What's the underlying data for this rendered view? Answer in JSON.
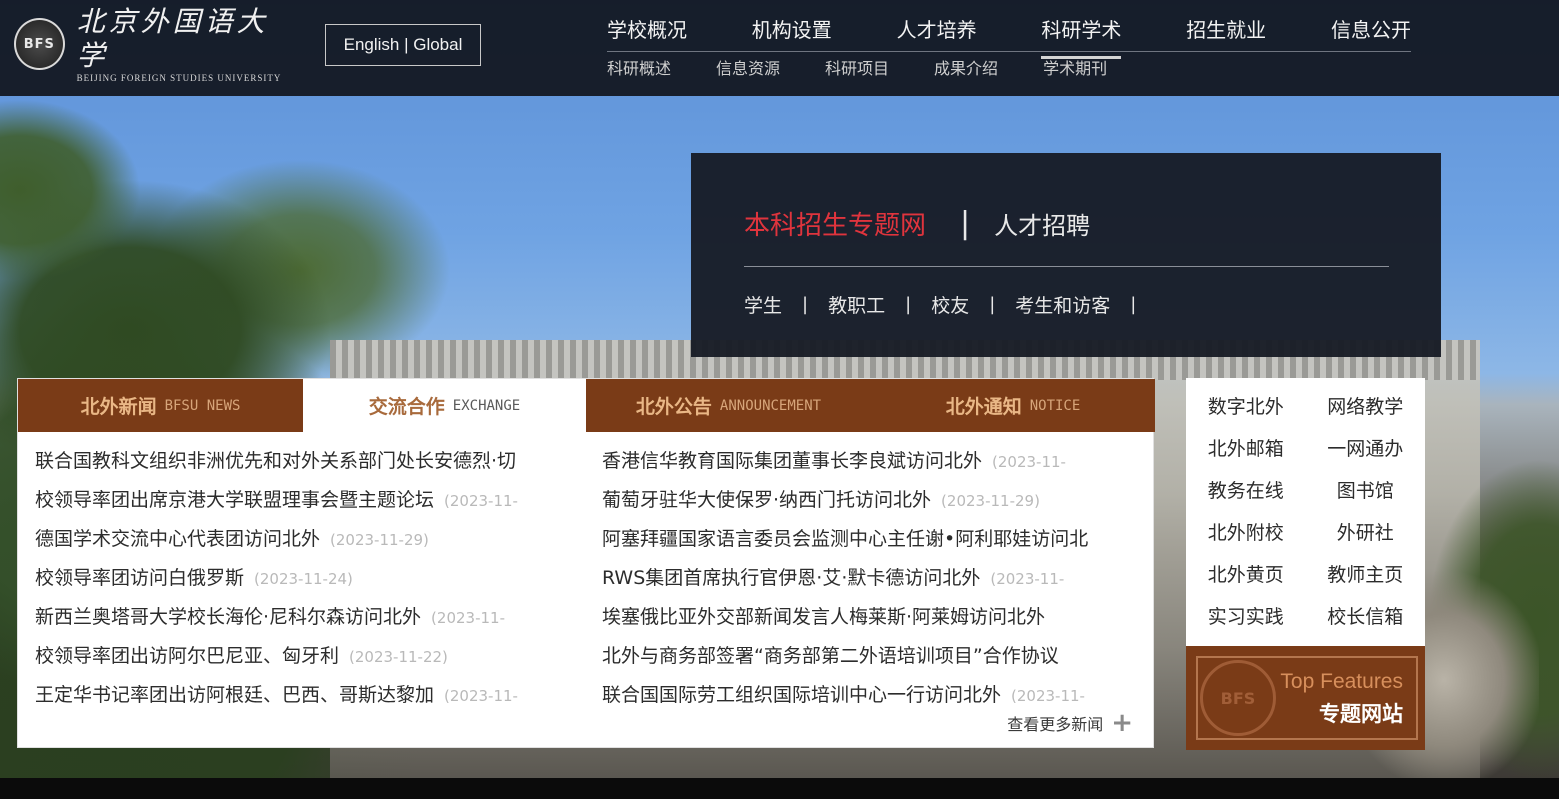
{
  "header": {
    "logo": {
      "cn": "北京外国语大学",
      "en": "Beijing Foreign Studies University",
      "seal_text": "BFS"
    },
    "lang_switch": "English | Global",
    "nav_main": [
      "学校概况",
      "机构设置",
      "人才培养",
      "科研学术",
      "招生就业",
      "信息公开"
    ],
    "nav_main_active": "科研学术",
    "nav_sub": [
      "科研概述",
      "信息资源",
      "科研项目",
      "成果介绍",
      "学术期刊"
    ]
  },
  "quick_box": {
    "admission": "本科招生专题网",
    "separator": "|",
    "recruit": "人才招聘",
    "audience": [
      "学生",
      "教职工",
      "校友",
      "考生和访客"
    ],
    "pipe": "|"
  },
  "news": {
    "tabs": [
      {
        "cn": "北外新闻",
        "en": "BFSU NEWS",
        "active": false
      },
      {
        "cn": "交流合作",
        "en": "EXCHANGE",
        "active": true
      },
      {
        "cn": "北外公告",
        "en": "ANNOUNCEMENT",
        "active": false
      },
      {
        "cn": "北外通知",
        "en": "NOTICE",
        "active": false
      }
    ],
    "left": [
      {
        "title": "联合国教科文组织非洲优先和对外关系部门处长安德烈·切",
        "date": ""
      },
      {
        "title": "校领导率团出席京港大学联盟理事会暨主题论坛",
        "date": "(2023-11-"
      },
      {
        "title": "德国学术交流中心代表团访问北外",
        "date": "(2023-11-29)"
      },
      {
        "title": "校领导率团访问白俄罗斯",
        "date": "(2023-11-24)"
      },
      {
        "title": "新西兰奥塔哥大学校长海伦·尼科尔森访问北外",
        "date": "(2023-11-"
      },
      {
        "title": "校领导率团出访阿尔巴尼亚、匈牙利",
        "date": "(2023-11-22)"
      },
      {
        "title": "王定华书记率团出访阿根廷、巴西、哥斯达黎加",
        "date": "(2023-11-"
      }
    ],
    "right": [
      {
        "title": "香港信华教育国际集团董事长李良斌访问北外",
        "date": "(2023-11-"
      },
      {
        "title": "葡萄牙驻华大使保罗·纳西门托访问北外",
        "date": "(2023-11-29)"
      },
      {
        "title": "阿塞拜疆国家语言委员会监测中心主任谢•阿利耶娃访问北",
        "date": ""
      },
      {
        "title": "RWS集团首席执行官伊恩·艾·默卡德访问北外",
        "date": "(2023-11-"
      },
      {
        "title": "埃塞俄比亚外交部新闻发言人梅莱斯·阿莱姆访问北外",
        "date": ""
      },
      {
        "title": "北外与商务部签署“商务部第二外语培训项目”合作协议",
        "date": ""
      },
      {
        "title": "联合国国际劳工组织国际培训中心一行访问北外",
        "date": "(2023-11-"
      }
    ],
    "more": "查看更多新闻",
    "more_icon": "+"
  },
  "quick_links": [
    "数字北外",
    "网络教学",
    "北外邮箱",
    "一网通办",
    "教务在线",
    "图书馆",
    "北外附校",
    "外研社",
    "北外黄页",
    "教师主页",
    "实习实践",
    "校长信箱"
  ],
  "features": {
    "en": "Top Features",
    "cn": "专题网站",
    "seal_text": "BFS"
  },
  "colors": {
    "header_bg": "#121620",
    "tab_brown": "#7a3b17",
    "tab_text": "#e9b786",
    "admission_red": "#e0343d"
  }
}
